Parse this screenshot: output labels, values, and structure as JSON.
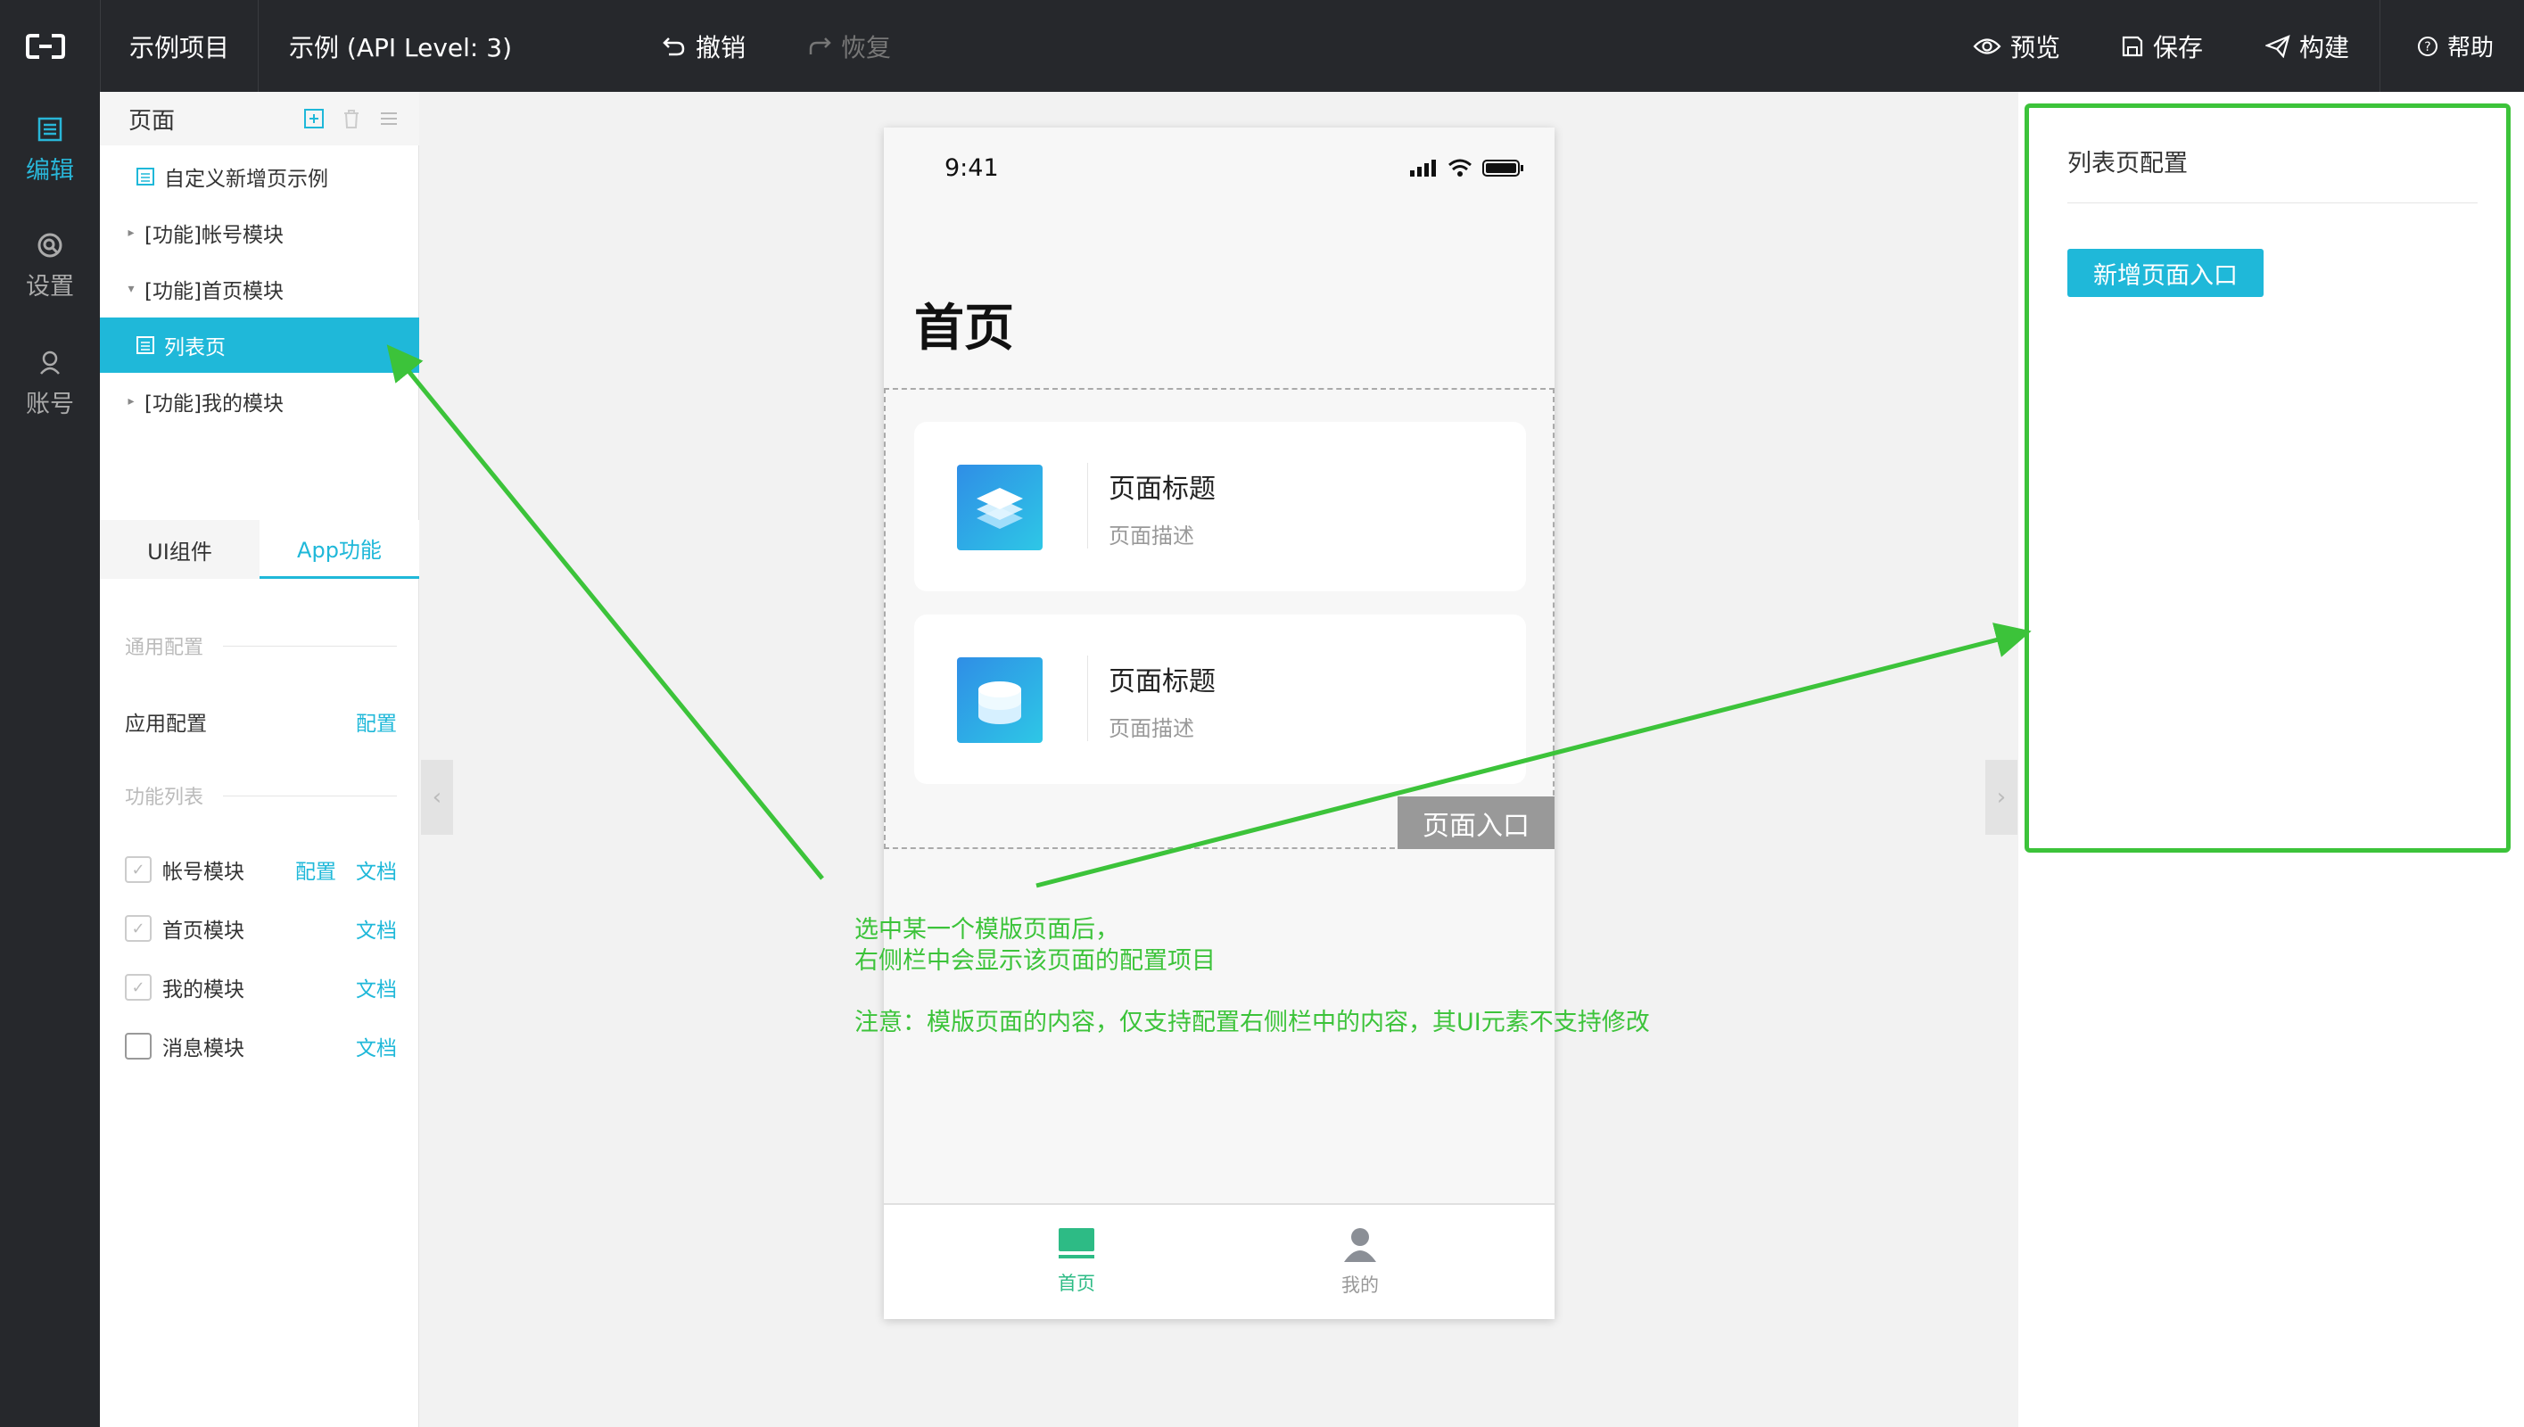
{
  "topbar": {
    "project_name": "示例项目",
    "app_name": "示例 (API Level: 3)",
    "undo_label": "撤销",
    "redo_label": "恢复",
    "preview_label": "预览",
    "save_label": "保存",
    "build_label": "构建",
    "help_label": "帮助"
  },
  "leftnav": {
    "items": [
      {
        "label": "编辑",
        "icon": "edit-icon",
        "active": true
      },
      {
        "label": "设置",
        "icon": "settings-icon",
        "active": false
      },
      {
        "label": "账号",
        "icon": "account-icon",
        "active": false
      }
    ]
  },
  "pages": {
    "header": "页面",
    "tree": [
      {
        "label": "自定义新增页示例"
      },
      {
        "label": "[功能]帐号模块"
      },
      {
        "label": "[功能]首页模块"
      },
      {
        "label": "列表页"
      },
      {
        "label": "[功能]我的模块"
      }
    ]
  },
  "tabs": {
    "ui_label": "UI组件",
    "app_label": "App功能"
  },
  "app_features": {
    "general_title": "通用配置",
    "app_config_label": "应用配置",
    "config_link": "配置",
    "feature_list_title": "功能列表",
    "doc_link": "文档",
    "modules": [
      {
        "label": "帐号模块",
        "checked": true,
        "has_config": true
      },
      {
        "label": "首页模块",
        "checked": true,
        "has_config": false
      },
      {
        "label": "我的模块",
        "checked": true,
        "has_config": false
      },
      {
        "label": "消息模块",
        "checked": false,
        "has_config": false
      }
    ]
  },
  "phone": {
    "time": "9:41",
    "title": "首页",
    "cards": [
      {
        "title": "页面标题",
        "desc": "页面描述"
      },
      {
        "title": "页面标题",
        "desc": "页面描述"
      }
    ],
    "entry_badge": "页面入口",
    "tabbar": {
      "home": "首页",
      "mine": "我的"
    }
  },
  "rightpanel": {
    "title": "列表页配置",
    "add_button": "新增页面入口"
  },
  "annotation": {
    "line1": "选中某一个模版页面后，",
    "line2": "右侧栏中会显示该页面的配置项目",
    "line3": "注意：模版页面的内容，仅支持配置右侧栏中的内容，其UI元素不支持修改"
  },
  "colors": {
    "accent": "#1fb8d9",
    "annotation_green": "#3cc33a",
    "tabbar_active": "#2dbb85",
    "topbar_bg": "#26282c"
  }
}
